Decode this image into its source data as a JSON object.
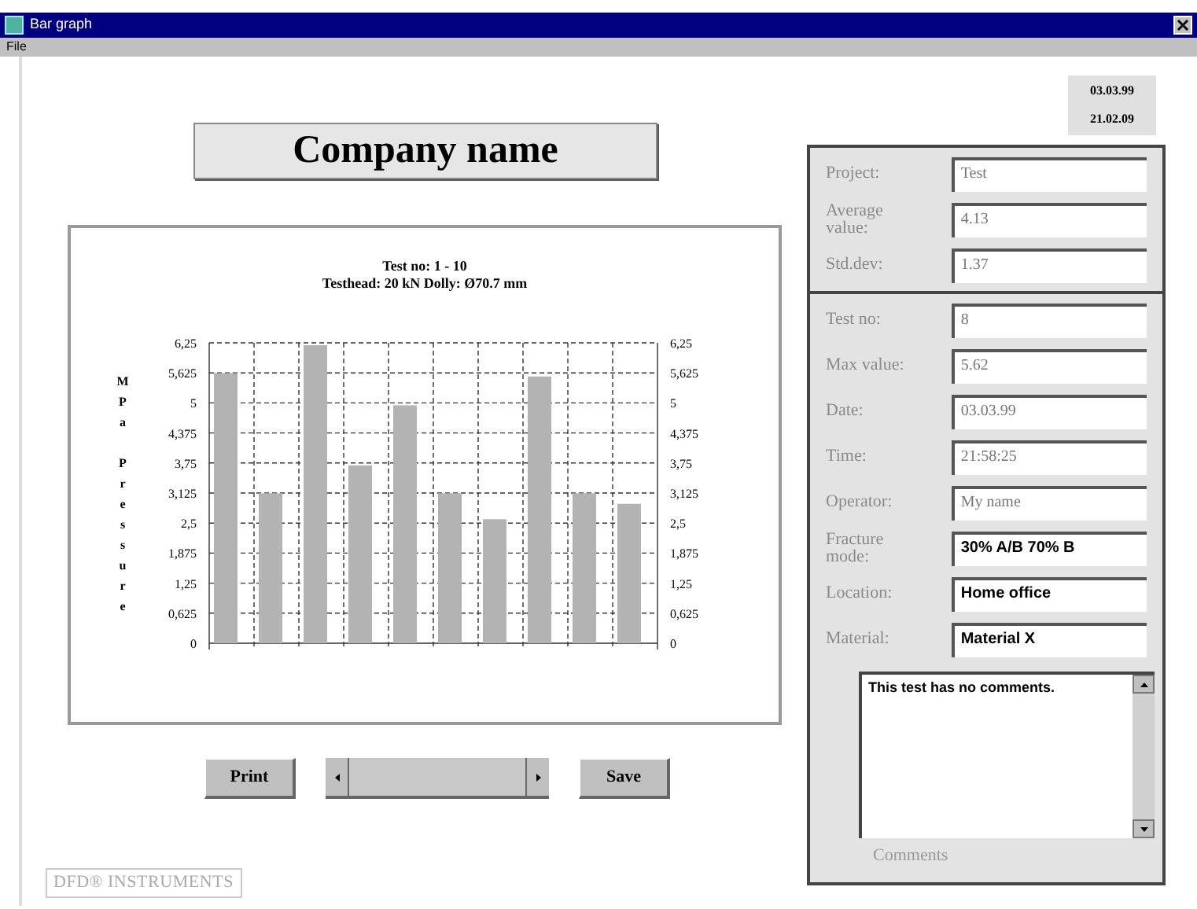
{
  "window": {
    "title": "Bar graph"
  },
  "menu": [
    "File"
  ],
  "header": {
    "company": "Company name"
  },
  "stamp": [
    "03.03.99",
    "21.02.09"
  ],
  "chart": {
    "chart_data": {
      "type": "bar",
      "title": "Test no: 1 -  10\nTesthead: 20 kN Dolly: Ø70.7 mm",
      "ylabel": "MPa Pressure",
      "ylim": [
        0,
        6.25
      ],
      "yticks": [
        {
          "value": 0,
          "label": "0"
        },
        {
          "value": 0.625,
          "label": "0,625"
        },
        {
          "value": 1.25,
          "label": "1,25"
        },
        {
          "value": 1.875,
          "label": "1,875"
        },
        {
          "value": 2.5,
          "label": "2,5"
        },
        {
          "value": 3.125,
          "label": "3,125"
        },
        {
          "value": 3.75,
          "label": "3,75"
        },
        {
          "value": 4.375,
          "label": "4,375"
        },
        {
          "value": 5,
          "label": "5"
        },
        {
          "value": 5.625,
          "label": "5,625"
        },
        {
          "value": 6.25,
          "label": "6,25"
        }
      ],
      "values": [
        5.62,
        3.12,
        6.2,
        3.7,
        4.95,
        3.12,
        2.58,
        5.55,
        3.12,
        2.9
      ],
      "grid": true
    }
  },
  "buttons": {
    "print": "Print",
    "save": "Save"
  },
  "logo": "DFD® INSTRUMENTS",
  "summary": [
    {
      "label": "Project:",
      "value": "Test",
      "emphasis": false
    },
    {
      "label": "Average value:",
      "value": "4.13",
      "emphasis": false
    },
    {
      "label": "Std.dev:",
      "value": "1.37",
      "emphasis": false
    }
  ],
  "details": [
    {
      "label": "Test no:",
      "value": "8",
      "emphasis": false
    },
    {
      "label": "Max value:",
      "value": "5.62",
      "emphasis": false
    },
    {
      "label": "Date:",
      "value": "03.03.99",
      "emphasis": false
    },
    {
      "label": "Time:",
      "value": "21:58:25",
      "emphasis": false
    },
    {
      "label": "Operator:",
      "value": "My name",
      "emphasis": false
    },
    {
      "label": "Fracture mode:",
      "value": "30% A/B 70% B",
      "emphasis": true
    },
    {
      "label": "Location:",
      "value": "Home office",
      "emphasis": true
    },
    {
      "label": "Material:",
      "value": "Material X",
      "emphasis": true
    }
  ],
  "comments": {
    "label": "Comments",
    "value": "This test has no comments."
  }
}
